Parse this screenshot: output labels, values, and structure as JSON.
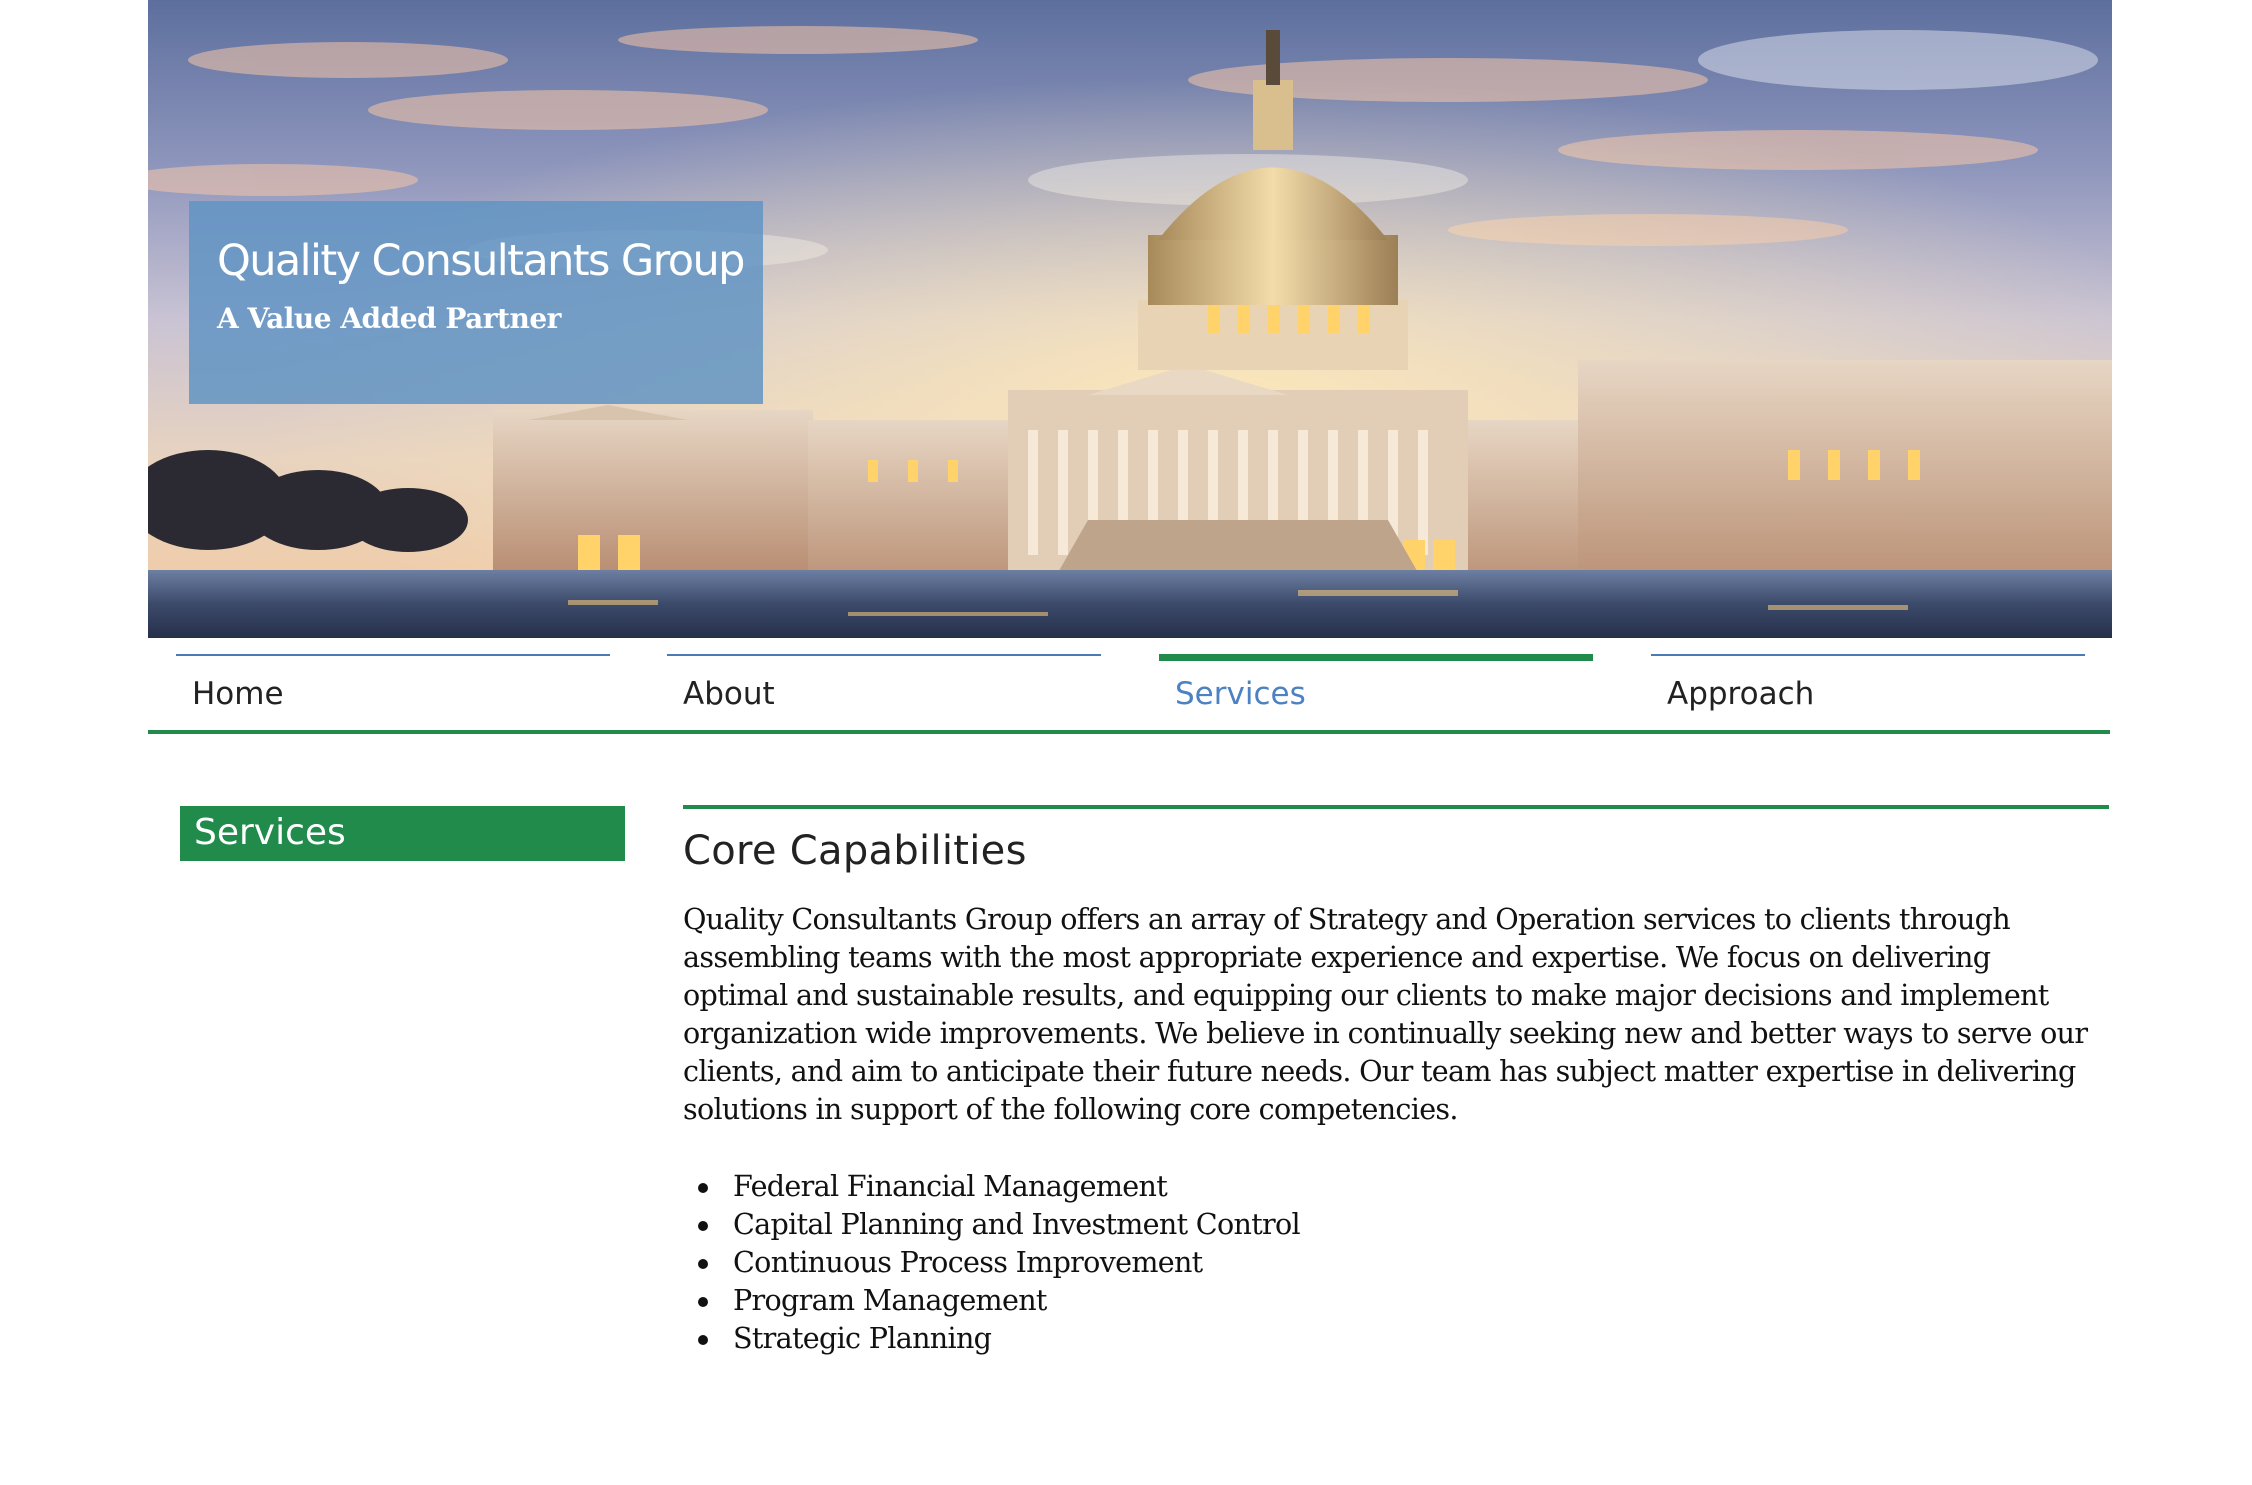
{
  "site": {
    "title": "Quality Consultants Group",
    "tagline": "A Value Added Partner"
  },
  "hero": {
    "image_description": "U.S. Capitol building at sunset with reflecting pool"
  },
  "nav": {
    "items": [
      {
        "label": "Home",
        "active": false
      },
      {
        "label": "About",
        "active": false
      },
      {
        "label": "Services",
        "active": true
      },
      {
        "label": "Approach",
        "active": false
      }
    ]
  },
  "sidebar": {
    "heading": "Services"
  },
  "main": {
    "heading": "Core Capabilities",
    "intro": "Quality Consultants Group offers an array of Strategy and Operation services to clients through assembling teams with the most appropriate experience and expertise. We focus on delivering optimal and sustainable results, and equipping our clients to make major decisions and implement organization wide improvements. We believe in continually seeking new and better ways to serve our clients, and aim to anticipate their future needs. Our team has subject matter expertise in delivering solutions in support of the following core competencies.",
    "competencies": [
      "Federal Financial Management",
      "Capital Planning and Investment Control",
      "Continuous Process Improvement",
      "Program Management",
      "Strategic Planning"
    ]
  },
  "colors": {
    "accent_green": "#208b4a",
    "nav_line_blue": "#4a7ab8",
    "active_nav_text": "#4d82c2",
    "title_box": "#6094c4"
  }
}
